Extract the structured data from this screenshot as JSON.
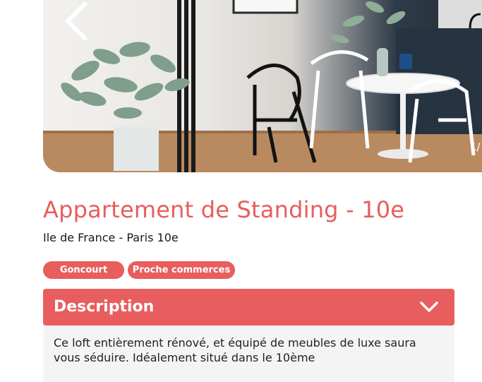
{
  "gallery": {
    "counter": "1/",
    "prev_icon": "chevron-left-icon"
  },
  "listing": {
    "title": "Appartement de Standing - 10e",
    "location": "Ile de France - Paris 10e",
    "tags": [
      "Goncourt",
      "Proche commerces"
    ]
  },
  "description": {
    "heading": "Description",
    "toggle_icon": "chevron-down-icon",
    "text": "Ce loft entièrement rénové, et équipé de meubles de luxe saura vous séduire. Idéalement situé dans le 10ème"
  },
  "colors": {
    "accent": "#e85d5d",
    "panel": "#f4f4f4"
  }
}
